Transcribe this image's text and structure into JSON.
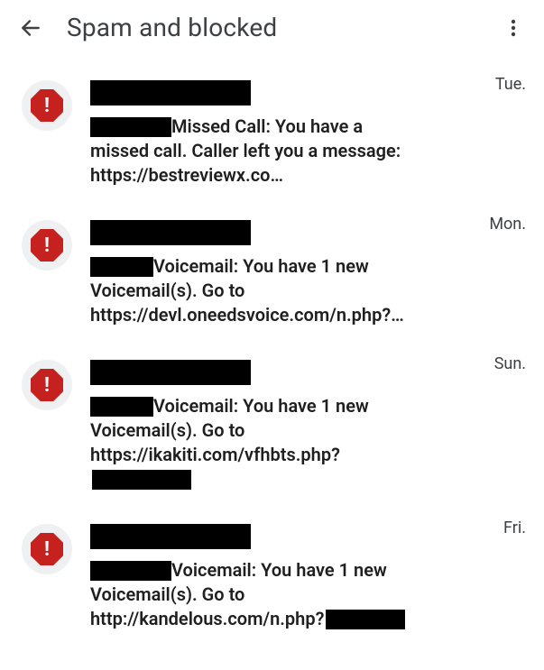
{
  "header": {
    "title": "Spam and blocked"
  },
  "items": [
    {
      "timestamp": "Tue.",
      "message": "Missed Call: You have a missed call. Caller left you a message: https://bestreviewx.co…",
      "has_lead_redact": true,
      "has_trail_redact": false
    },
    {
      "timestamp": "Mon.",
      "message": "Voicemail: You have 1 new Voicemail(s). Go to https://devl.oneedsvoice.com/n.php?…",
      "has_lead_redact": true,
      "has_trail_redact": false,
      "lead_short": true
    },
    {
      "timestamp": "Sun.",
      "message": "Voicemail: You have 1 new Voicemail(s). Go to https://ikakiti.com/vfhbts.php?",
      "has_lead_redact": true,
      "has_trail_redact": true,
      "lead_short": true
    },
    {
      "timestamp": "Fri.",
      "message": "Voicemail: You have 1 new Voicemail(s). Go to http://kandelous.com/n.php?",
      "has_lead_redact": true,
      "has_trail_redact": true,
      "lead_short": false,
      "trail_short": true
    }
  ]
}
